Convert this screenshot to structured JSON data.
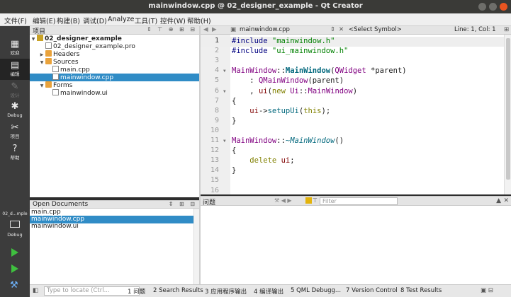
{
  "window": {
    "title": "mainwindow.cpp @ 02_designer_example - Qt Creator"
  },
  "menubar": [
    "文件(F)",
    "编辑(E)",
    "构建(B)",
    "调试(D)",
    "Analyze",
    "工具(T)",
    "控件(W)",
    "帮助(H)"
  ],
  "modes": [
    {
      "label": "欢迎",
      "icon": "welcome-grid-icon"
    },
    {
      "label": "编辑",
      "icon": "edit-document-icon"
    },
    {
      "label": "设计",
      "icon": "design-pen-icon"
    },
    {
      "label": "Debug",
      "icon": "debug-bug-icon"
    },
    {
      "label": "项目",
      "icon": "wrench-icon"
    },
    {
      "label": "帮助",
      "icon": "help-icon"
    }
  ],
  "kit": {
    "name": "02_d...mple",
    "label": "Debug"
  },
  "project_pane": {
    "title": "项目",
    "tree": [
      {
        "label": "02_designer_example",
        "level": 0,
        "kind": "proj",
        "expanded": true,
        "bold": true
      },
      {
        "label": "02_designer_example.pro",
        "level": 1,
        "kind": "file"
      },
      {
        "label": "Headers",
        "level": 1,
        "kind": "folder",
        "expanded": false
      },
      {
        "label": "Sources",
        "level": 1,
        "kind": "folder",
        "expanded": true
      },
      {
        "label": "main.cpp",
        "level": 2,
        "kind": "file"
      },
      {
        "label": "mainwindow.cpp",
        "level": 2,
        "kind": "file",
        "selected": true
      },
      {
        "label": "Forms",
        "level": 1,
        "kind": "folder",
        "expanded": true
      },
      {
        "label": "mainwindow.ui",
        "level": 2,
        "kind": "ui"
      }
    ]
  },
  "open_documents": {
    "title": "Open Documents",
    "items": [
      {
        "label": "main.cpp"
      },
      {
        "label": "mainwindow.cpp",
        "selected": true
      },
      {
        "label": "mainwindow.ui"
      }
    ]
  },
  "editor": {
    "file": "mainwindow.cpp",
    "symbol": "<Select Symbol>",
    "position": "Line: 1, Col: 1",
    "lines": [
      "#include \"mainwindow.h\"",
      "#include \"ui_mainwindow.h\"",
      "",
      "MainWindow::MainWindow(QWidget *parent)",
      "    : QMainWindow(parent)",
      "    , ui(new Ui::MainWindow)",
      "{",
      "    ui->setupUi(this);",
      "}",
      "",
      "MainWindow::~MainWindow()",
      "{",
      "    delete ui;",
      "}",
      "",
      ""
    ]
  },
  "issues": {
    "title": "问题",
    "filter_placeholder": "Filter"
  },
  "statusbar": {
    "locate_placeholder": "Type to locate (Ctrl...",
    "panes": [
      "1 问题",
      "2 Search Results",
      "3 应用程序输出",
      "4 编译输出",
      "5 QML Debugg...",
      "7 Version Control",
      "8 Test Results"
    ]
  },
  "colors": {
    "accent": "#308cc6",
    "sidebar": "#3c3c3c",
    "run": "#3fbf3f",
    "close": "#e95420"
  }
}
